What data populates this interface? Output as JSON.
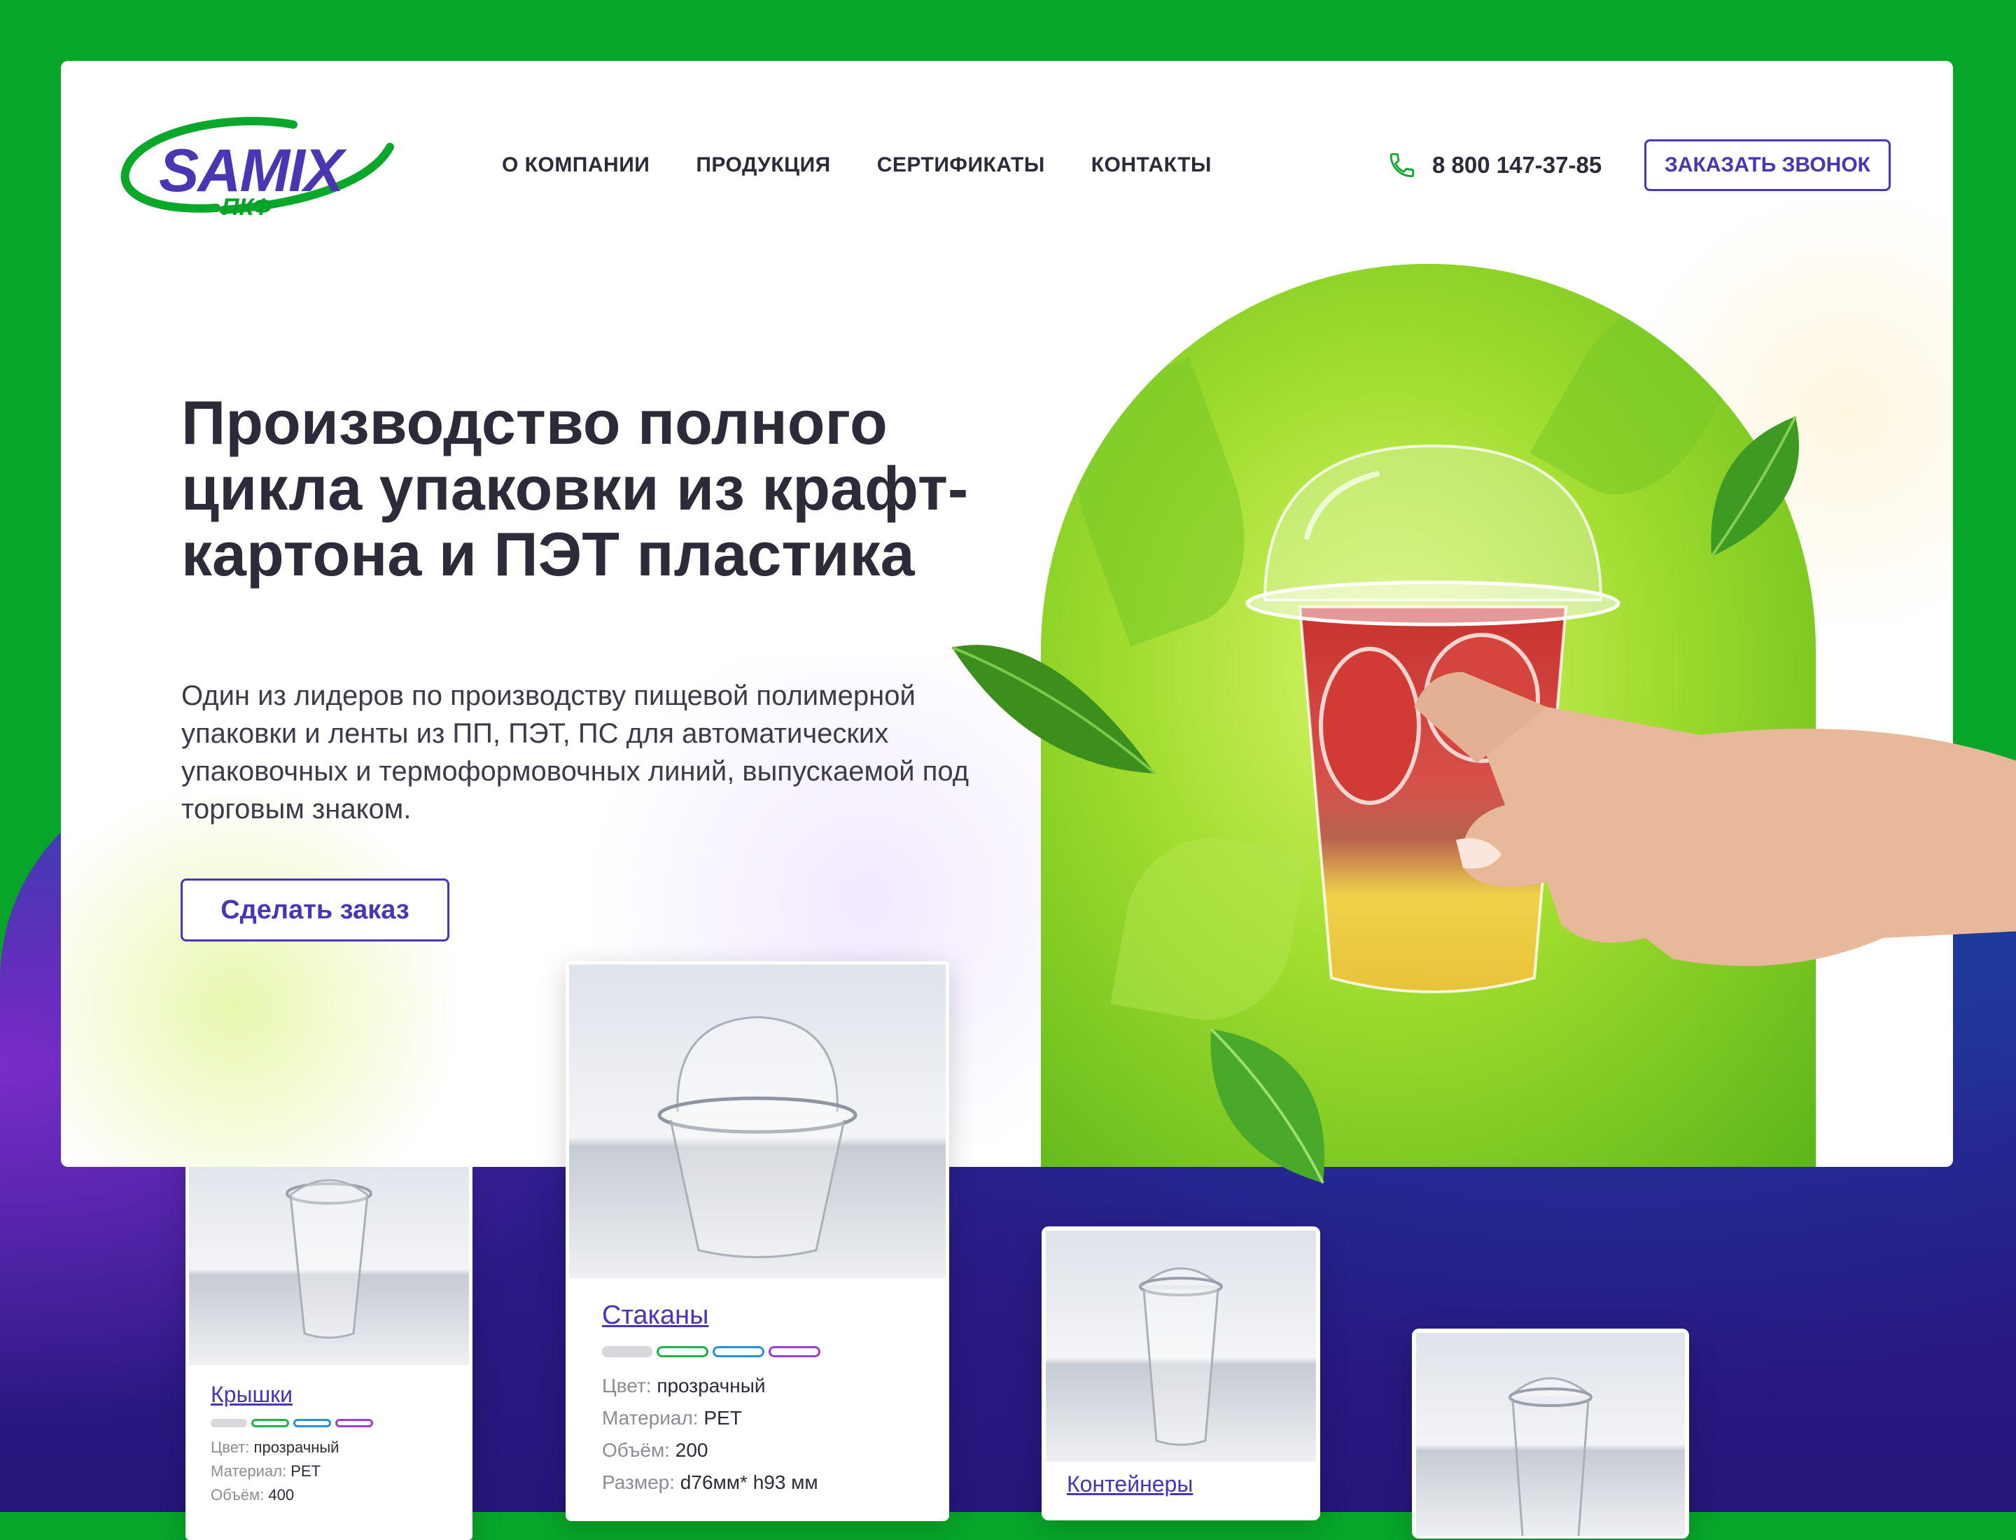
{
  "brand": {
    "name": "SAMIX",
    "sub": "ПКФ",
    "green": "#0aa82a",
    "purple": "#4a35b2"
  },
  "nav": [
    {
      "label": "О КОМПАНИИ"
    },
    {
      "label": "ПРОДУКЦИЯ"
    },
    {
      "label": "СЕРТИФИКАТЫ"
    },
    {
      "label": "КОНТАКТЫ"
    }
  ],
  "header": {
    "phone": "8 800 147-37-85",
    "callback_label": "ЗАКАЗАТЬ ЗВОНОК"
  },
  "hero": {
    "title": "Производство полного цикла упаковки из крафт-картона и ПЭТ пластика",
    "description": "Один из лидеров по производству пищевой полимерной упаковки и ленты из ПП, ПЭТ, ПС для автоматических упаковочных и термоформовочных линий, выпускаемой под торговым знаком.",
    "cta_label": "Сделать заказ"
  },
  "products": [
    {
      "title": "Крышки",
      "specs": [
        {
          "label": "Цвет:",
          "value": "прозрачный"
        },
        {
          "label": "Материал:",
          "value": "PET"
        },
        {
          "label": "Объём:",
          "value": "400"
        }
      ]
    },
    {
      "title": "Стаканы",
      "specs": [
        {
          "label": "Цвет:",
          "value": "прозрачный"
        },
        {
          "label": "Материал:",
          "value": "PET"
        },
        {
          "label": "Объём:",
          "value": "200"
        },
        {
          "label": "Размер:",
          "value": "d76мм* h93 мм"
        }
      ]
    },
    {
      "title": "Контейнеры",
      "specs": []
    },
    {
      "title": "",
      "specs": []
    }
  ],
  "color_bars": [
    "#d8d8dc",
    "#1db34a",
    "#2a8fd6",
    "#9a3fd6"
  ],
  "icons": [
    "phone-icon",
    "leaf-icon",
    "cup-icon"
  ]
}
